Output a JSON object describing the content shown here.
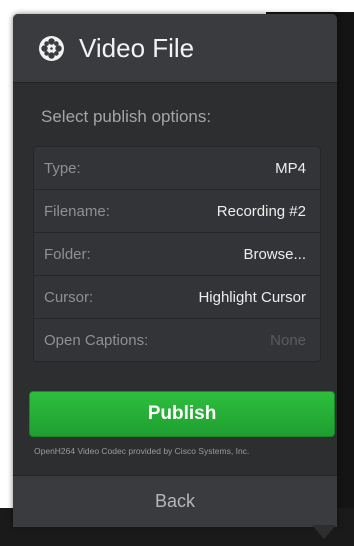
{
  "header": {
    "title": "Video File",
    "icon": "film-reel-icon"
  },
  "subtitle": "Select publish options:",
  "options": [
    {
      "label": "Type:",
      "value": "MP4"
    },
    {
      "label": "Filename:",
      "value": "Recording #2"
    },
    {
      "label": "Folder:",
      "value": "Browse..."
    },
    {
      "label": "Cursor:",
      "value": "Highlight Cursor"
    },
    {
      "label": "Open Captions:",
      "value": "None"
    }
  ],
  "publish_label": "Publish",
  "codec_note": "OpenH264 Video Codec provided by Cisco Systems, Inc.",
  "back_label": "Back",
  "colors": {
    "panel": "#2d2e30",
    "header": "#3a3b3e",
    "publish": "#22a834"
  }
}
